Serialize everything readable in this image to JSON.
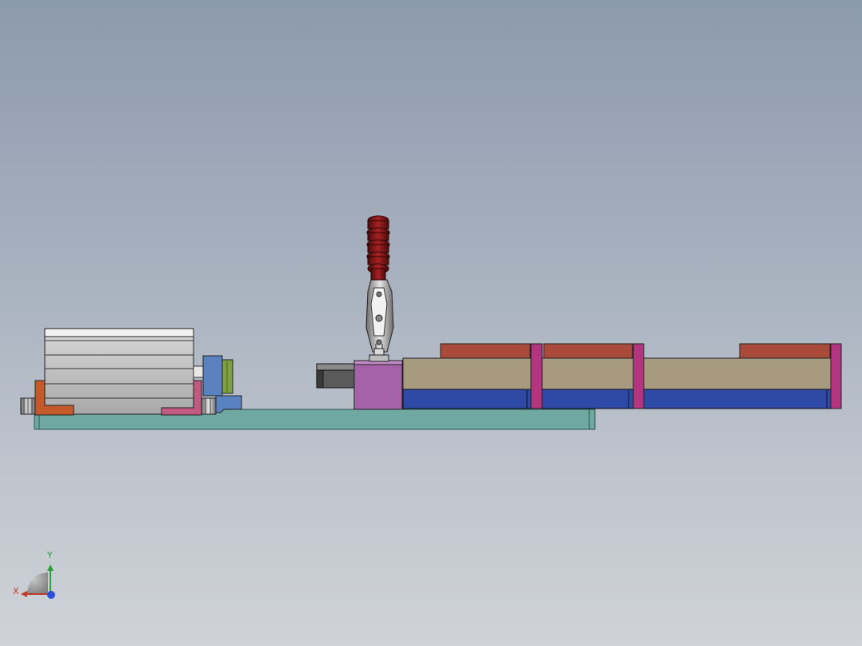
{
  "viewport": {
    "background_top": "#8c9aae",
    "background_bottom": "#cfd3d8"
  },
  "triad": {
    "x_label": "X",
    "y_label": "Y",
    "x_color": "#c0392b",
    "y_color": "#27a03a",
    "z_color": "#2b4fd8"
  },
  "model": {
    "parts": [
      "base-plate",
      "left-cylinder",
      "left-bracket",
      "guide-block",
      "toggle-clamp",
      "clamp-handle",
      "clamp-mount-block",
      "right-fixture-rail"
    ],
    "colors": {
      "base_plate": "#6ea8a0",
      "cylinder_body": "#c8c8c8",
      "bracket_orange": "#c45a2a",
      "bracket_pink": "#c05a80",
      "guide_blue": "#5b82c0",
      "guide_green": "#7ea040",
      "mount_block": "#a463a8",
      "handle_red": "#8b1a1a",
      "rail_tan": "#a79a7e",
      "rail_blue": "#2f49a6",
      "rail_red": "#a94a3a",
      "rail_magenta": "#b4357f"
    }
  }
}
